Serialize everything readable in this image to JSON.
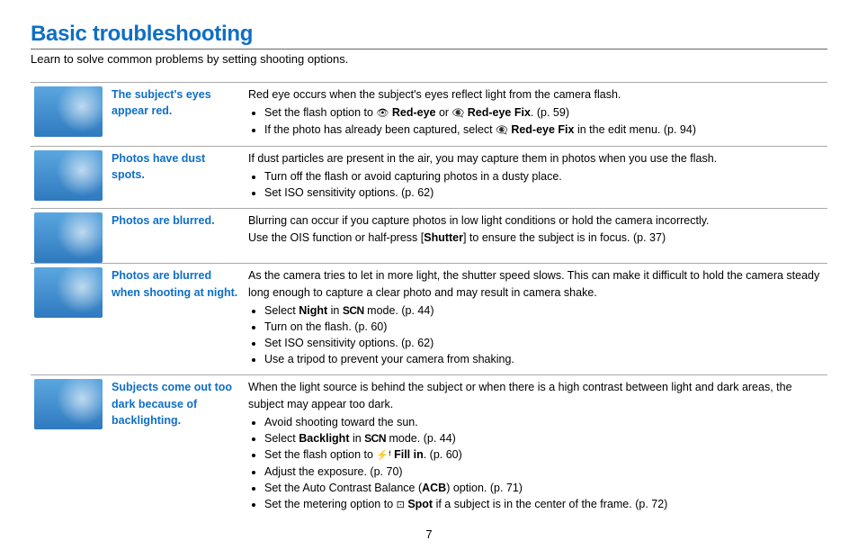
{
  "page": {
    "title": "Basic troubleshooting",
    "intro": "Learn to solve common problems by setting shooting options.",
    "number": "7"
  },
  "rows": [
    {
      "icon": "camera-redeye-icon",
      "topic": "The subject's eyes appear red.",
      "lead": "Red eye occurs when the subject's eyes reflect light from the camera flash.",
      "bullets": [
        {
          "prefix": "Set the flash option to ",
          "glyph": "👁",
          "bold": "Red-eye",
          "mid": " or ",
          "glyph2": "👁‍🗨",
          "bold2": "Red-eye Fix",
          "tail": ". (p. 59)"
        },
        {
          "prefix": "If the photo has already been captured, select ",
          "glyph": "👁‍🗨",
          "bold": "Red-eye Fix",
          "tail": " in the edit menu. (p. 94)"
        }
      ]
    },
    {
      "icon": "dust-photos-icon",
      "topic": "Photos have dust spots.",
      "lead": "If dust particles are present in the air, you may capture them in photos when you use the flash.",
      "bullets": [
        {
          "text": "Turn off the flash or avoid capturing photos in a dusty place."
        },
        {
          "text": "Set ISO sensitivity options. (p. 62)"
        }
      ]
    },
    {
      "icon": "blurred-person-icon",
      "topic": "Photos are blurred.",
      "lead_parts": {
        "line1": "Blurring can occur if you capture photos in low light conditions or hold the camera incorrectly.",
        "line2a": "Use the OIS function or half-press [",
        "line2bold": "Shutter",
        "line2b": "] to ensure the subject is in focus. (p. 37)"
      }
    },
    {
      "icon": "night-city-icon",
      "topic": "Photos are blurred when shooting at night.",
      "lead": "As the camera tries to let in more light, the shutter speed slows. This can make it difficult to hold the camera steady long enough to capture a clear photo and may result in camera shake.",
      "bullets": [
        {
          "prefix": "Select ",
          "bold": "Night",
          "mid": " in ",
          "scn": "SCN",
          "tail": " mode. (p. 44)"
        },
        {
          "text": "Turn on the flash. (p. 60)"
        },
        {
          "text": "Set ISO sensitivity options. (p. 62)"
        },
        {
          "text": "Use a tripod to prevent your camera from shaking."
        }
      ]
    },
    {
      "icon": "backlight-subject-icon",
      "topic": "Subjects come out too dark because of backlighting.",
      "lead": "When the light source is behind the subject or when there is a high contrast between light and dark areas, the subject may appear too dark.",
      "bullets": [
        {
          "text": "Avoid shooting toward the sun."
        },
        {
          "prefix": "Select ",
          "bold": "Backlight",
          "mid": " in ",
          "scn": "SCN",
          "tail": " mode. (p. 44)"
        },
        {
          "prefix": "Set the flash option to ",
          "glyph": "⚡ᶠ",
          "bold": " Fill in",
          "tail": ". (p. 60)"
        },
        {
          "text": "Adjust the exposure. (p. 70)"
        },
        {
          "prefix": "Set the Auto Contrast Balance (",
          "bold": "ACB",
          "tail": ") option. (p. 71)"
        },
        {
          "prefix": "Set the metering option to ",
          "glyph": "⊡",
          "bold": " Spot",
          "tail": " if a subject is in the center of the frame. (p. 72)"
        }
      ]
    }
  ]
}
